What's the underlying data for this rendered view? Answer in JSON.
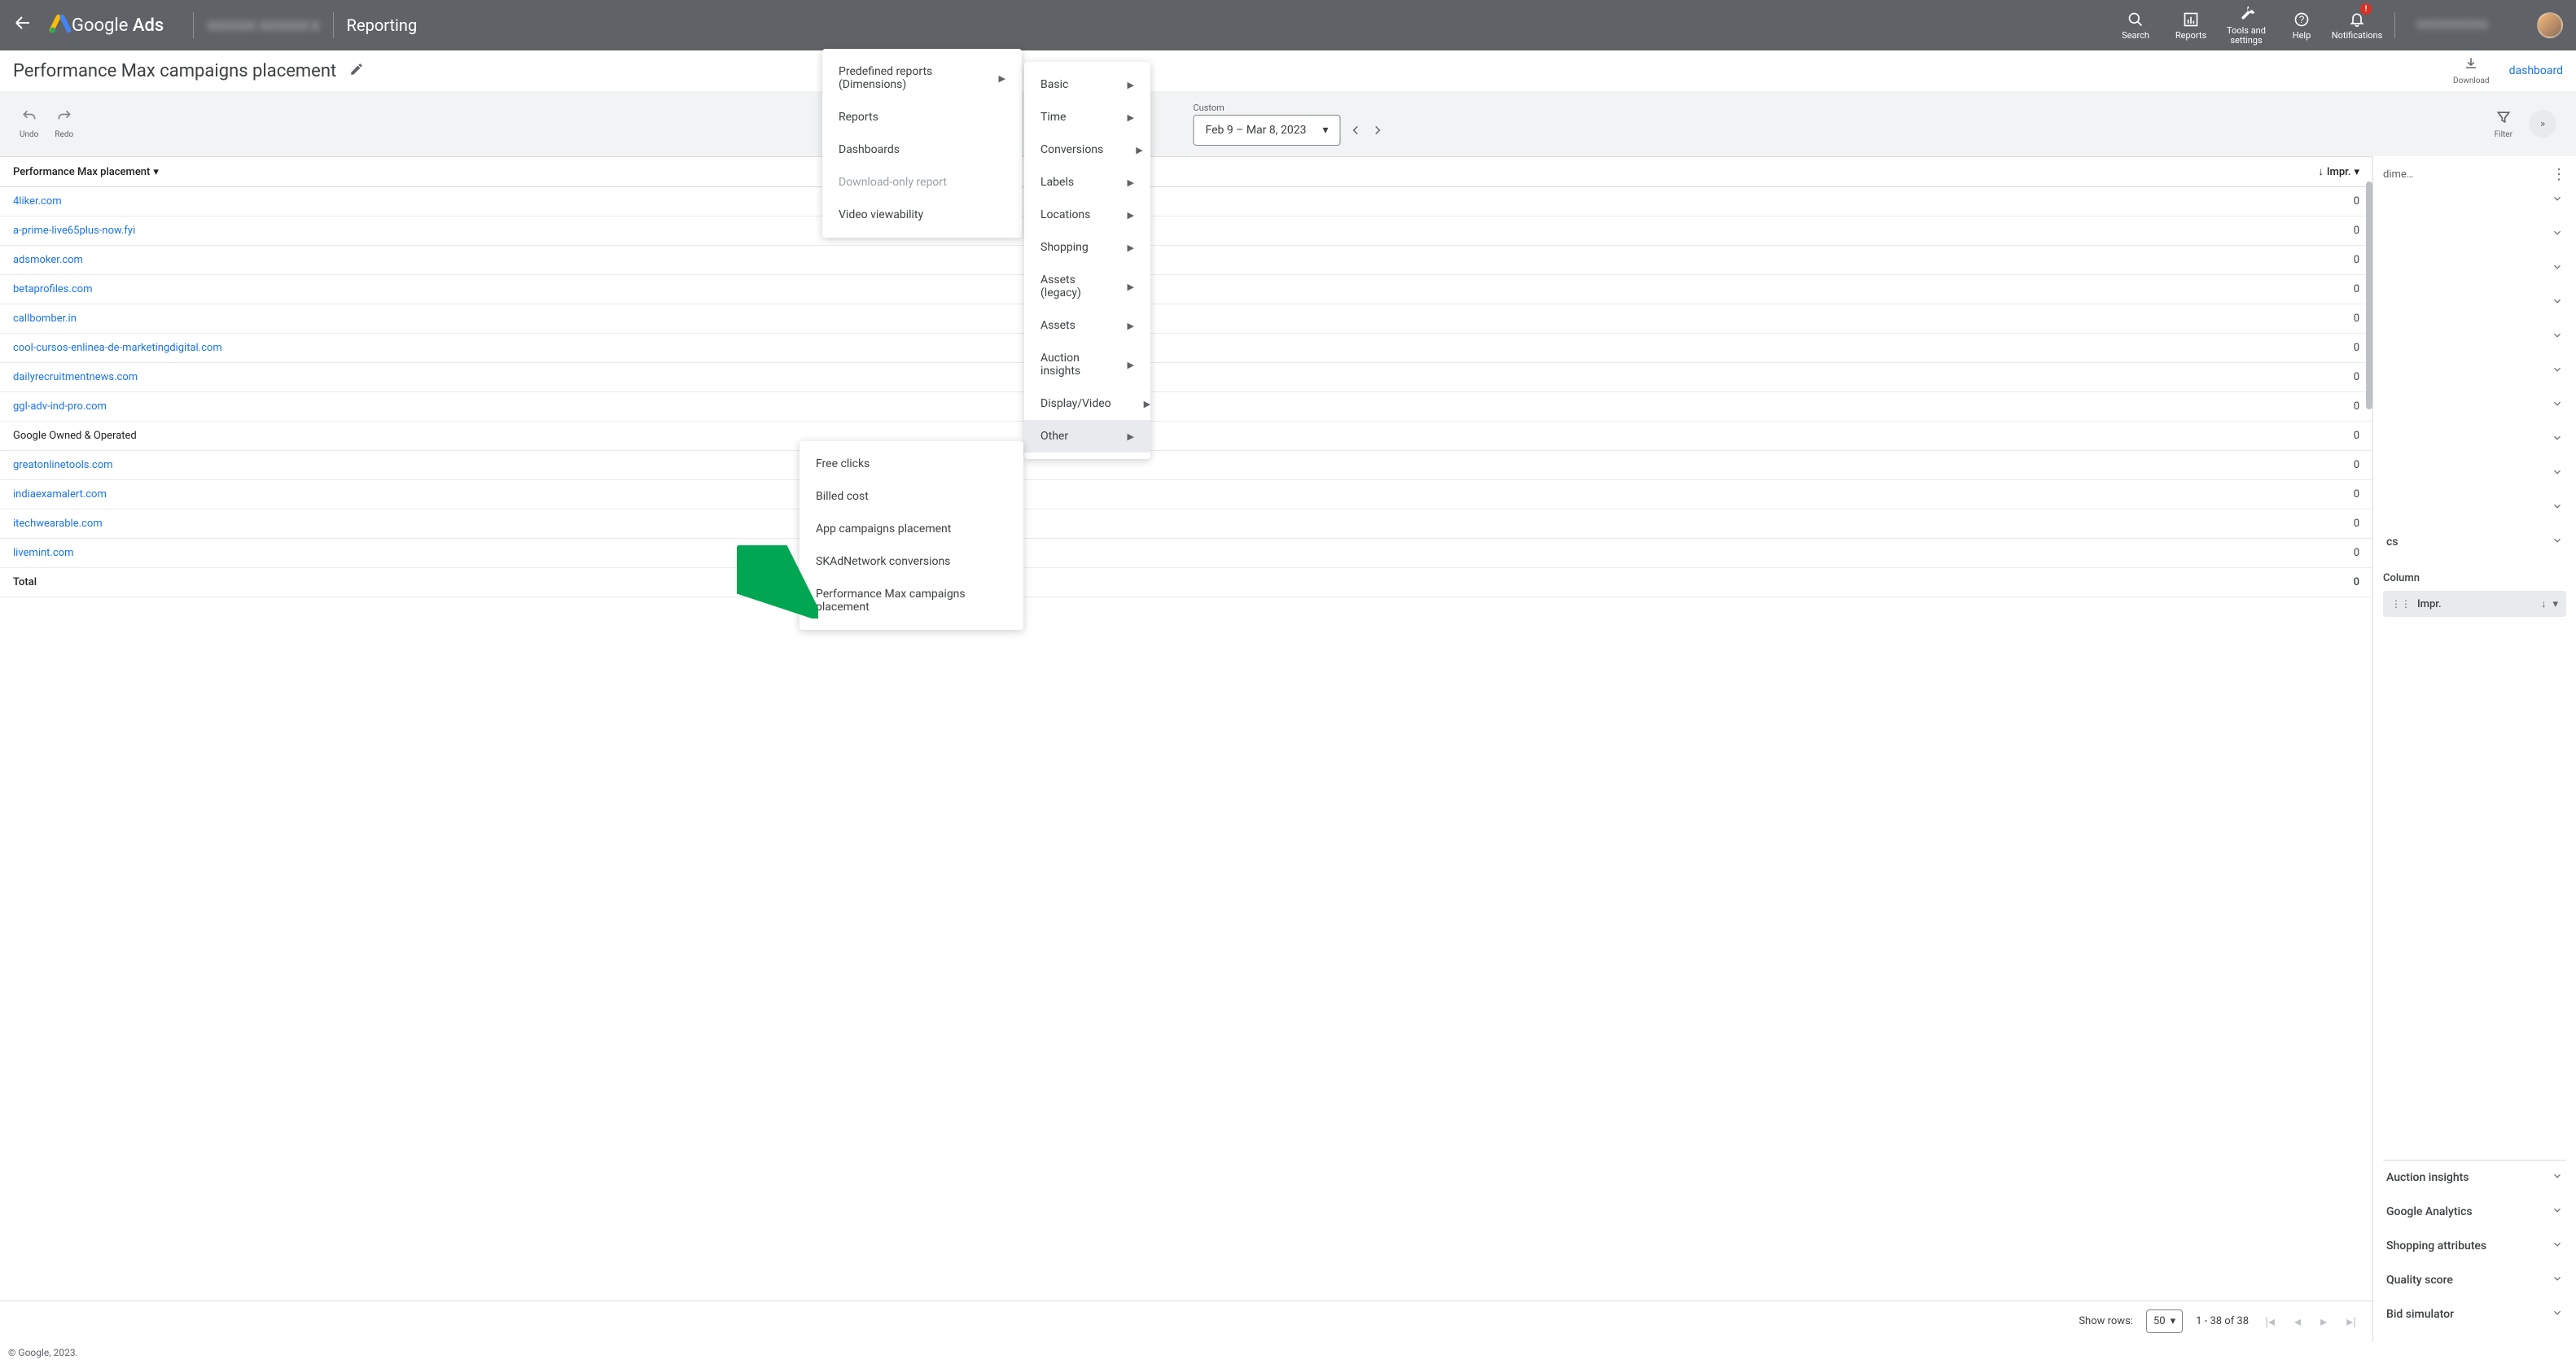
{
  "header": {
    "product": "Google",
    "product_suffix": "Ads",
    "account": "XXXXXX XXXXXX-X",
    "section": "Reporting",
    "actions": {
      "search": "Search",
      "reports": "Reports",
      "tools": "Tools and settings",
      "help": "Help",
      "notifications": "Notifications"
    },
    "notif_badge": "!",
    "account2": "XXXXXXXXXX"
  },
  "subheader": {
    "title": "Performance Max campaigns placement",
    "download": "Download",
    "save_dashboard": "dashboard"
  },
  "toolbar": {
    "undo": "Undo",
    "redo": "Redo",
    "date_label": "Custom",
    "date_range": "Feb 9 – Mar 8, 2023",
    "filter": "Filter"
  },
  "table": {
    "col_placement": "Performance Max placement",
    "col_impr": "Impr.",
    "rows": [
      {
        "placement": "4liker.com",
        "impr": "0",
        "link": true
      },
      {
        "placement": "a-prime-live65plus-now.fyi",
        "impr": "0",
        "link": true
      },
      {
        "placement": "adsmoker.com",
        "impr": "0",
        "link": true
      },
      {
        "placement": "betaprofiles.com",
        "impr": "0",
        "link": true
      },
      {
        "placement": "callbomber.in",
        "impr": "0",
        "link": true
      },
      {
        "placement": "cool-cursos-enlinea-de-marketingdigital.com",
        "impr": "0",
        "link": true
      },
      {
        "placement": "dailyrecruitmentnews.com",
        "impr": "0",
        "link": true
      },
      {
        "placement": "ggl-adv-ind-pro.com",
        "impr": "0",
        "link": true
      },
      {
        "placement": "Google Owned & Operated",
        "impr": "0",
        "link": false
      },
      {
        "placement": "greatonlinetools.com",
        "impr": "0",
        "link": true
      },
      {
        "placement": "indiaexamalert.com",
        "impr": "0",
        "link": true
      },
      {
        "placement": "itechwearable.com",
        "impr": "0",
        "link": true
      },
      {
        "placement": "livemint.com",
        "impr": "0",
        "link": true
      }
    ],
    "total_label": "Total",
    "total_impr": "0"
  },
  "pagination": {
    "show_rows": "Show rows:",
    "rows_value": "50",
    "range": "1 - 38 of 38"
  },
  "side": {
    "dim_text": "dime…",
    "column_label": "Column",
    "column_chip": "Impr.",
    "groups": [
      "Auction insights",
      "Google Analytics",
      "Shopping attributes",
      "Quality score",
      "Bid simulator"
    ],
    "hidden_groups_chev_count": 10,
    "hidden_label_cs": "cs"
  },
  "popover1": {
    "items": [
      {
        "label": "Predefined reports (Dimensions)",
        "arrow": true
      },
      {
        "label": "Reports"
      },
      {
        "label": "Dashboards"
      }
    ],
    "disabled": "Download-only report",
    "last": "Video viewability"
  },
  "popover2": {
    "items": [
      "Basic",
      "Time",
      "Conversions",
      "Labels",
      "Locations",
      "Shopping",
      "Assets (legacy)",
      "Assets",
      "Auction insights",
      "Display/Video",
      "Other"
    ]
  },
  "popover3": {
    "items": [
      "Free clicks",
      "Billed cost",
      "App campaigns placement",
      "SKAdNetwork conversions",
      "Performance Max campaigns placement"
    ]
  },
  "footer": "© Google, 2023."
}
